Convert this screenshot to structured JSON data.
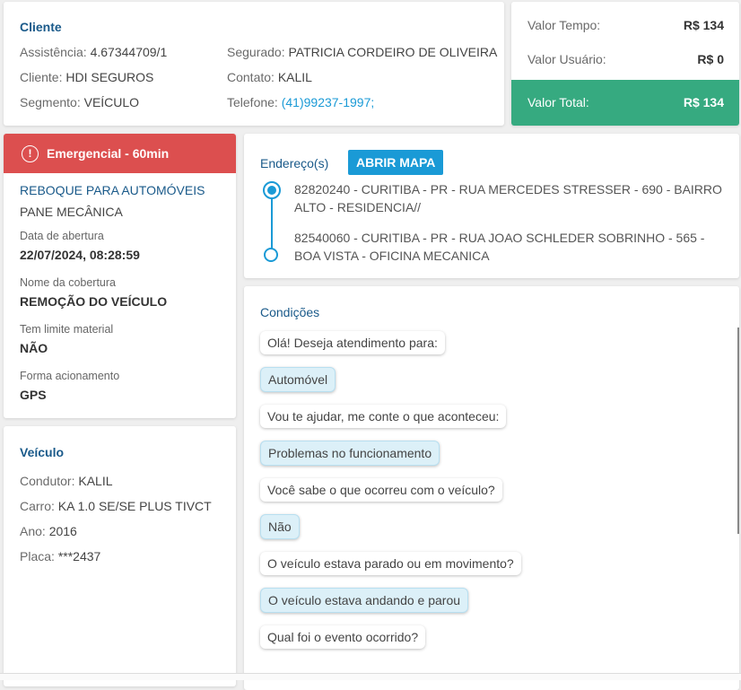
{
  "cliente": {
    "title": "Cliente",
    "left": [
      {
        "label": "Assistência:",
        "value": "4.67344709/1"
      },
      {
        "label": "Cliente:",
        "value": "HDI SEGUROS"
      },
      {
        "label": "Segmento:",
        "value": "VEÍCULO"
      }
    ],
    "right": [
      {
        "label": "Segurado:",
        "value": "PATRICIA CORDEIRO DE OLIVEIRA"
      },
      {
        "label": "Contato:",
        "value": "KALIL"
      },
      {
        "label": "Telefone:",
        "value": "(41)99237-1997;"
      }
    ]
  },
  "valores": {
    "tempo_label": "Valor Tempo:",
    "tempo": "R$ 134",
    "usuario_label": "Valor Usuário:",
    "usuario": "R$ 0",
    "total_label": "Valor Total:",
    "total": "R$ 134",
    "total_color": "#36aa80"
  },
  "servico": {
    "badge": "Emergencial - 60min",
    "badge_color": "#dc4f4f",
    "tipo": "REBOQUE PARA AUTOMÓVEIS",
    "motivo": "PANE MECÂNICA",
    "fields": [
      {
        "label": "Data de abertura",
        "value": "22/07/2024, 08:28:59"
      },
      {
        "label": "Nome da cobertura",
        "value": "REMOÇÃO DO VEÍCULO"
      },
      {
        "label": "Tem limite material",
        "value": "NÃO"
      },
      {
        "label": "Forma acionamento",
        "value": "GPS"
      }
    ]
  },
  "veiculo": {
    "title": "Veículo",
    "items": [
      {
        "label": "Condutor:",
        "value": "KALIL"
      },
      {
        "label": "Carro:",
        "value": "KA 1.0 SE/SE PLUS TIVCT"
      },
      {
        "label": "Ano:",
        "value": "2016"
      },
      {
        "label": "Placa:",
        "value": "***2437"
      }
    ]
  },
  "enderecos": {
    "title": "Endereço(s)",
    "button": "ABRIR MAPA",
    "items": [
      "82820240 - CURITIBA - PR - RUA MERCEDES STRESSER - 690 - BAIRRO ALTO - RESIDENCIA//",
      "82540060 - CURITIBA - PR - RUA JOAO SCHLEDER SOBRINHO - 565 - BOA VISTA - OFICINA MECANICA"
    ]
  },
  "condicoes": {
    "title": "Condições",
    "messages": [
      {
        "text": "Olá! Deseja atendimento para:",
        "answer": false
      },
      {
        "text": "Automóvel",
        "answer": true
      },
      {
        "text": "Vou te ajudar, me conte o que aconteceu:",
        "answer": false
      },
      {
        "text": "Problemas no funcionamento",
        "answer": true
      },
      {
        "text": "Você sabe o que ocorreu com o veículo?",
        "answer": false
      },
      {
        "text": "Não",
        "answer": true
      },
      {
        "text": "O veículo estava parado ou em movimento?",
        "answer": false
      },
      {
        "text": "O veículo estava andando e parou",
        "answer": true
      },
      {
        "text": "Qual foi o evento ocorrido?",
        "answer": false
      }
    ]
  }
}
